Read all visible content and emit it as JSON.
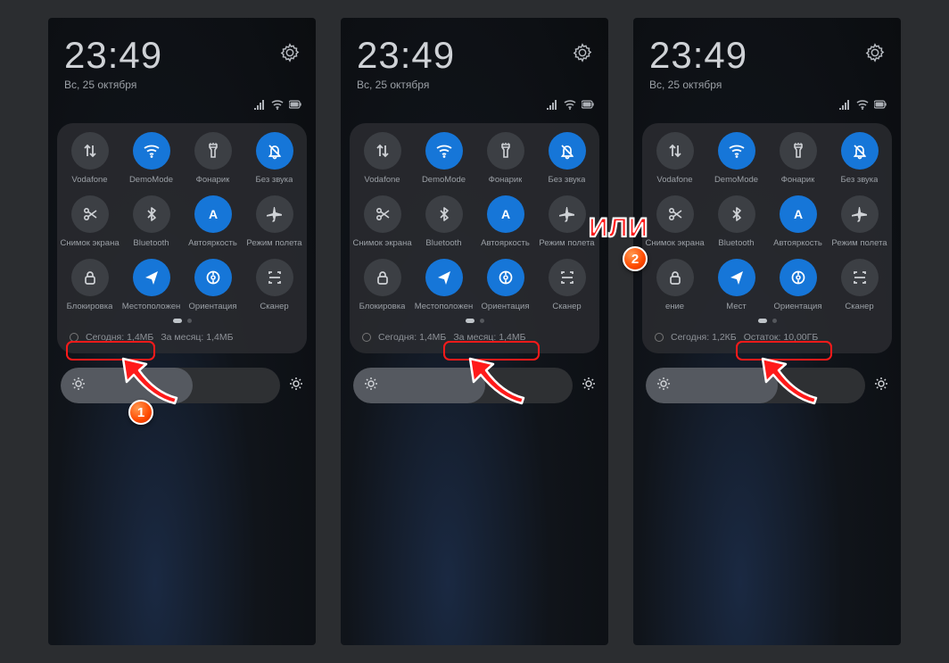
{
  "annotation": {
    "or_label": "ИЛИ",
    "marker1": "1",
    "marker2": "2"
  },
  "common": {
    "time": "23:49",
    "date": "Вс, 25 октября",
    "tiles": [
      {
        "label": "Vodafone",
        "icon": "data-arrows",
        "active": false
      },
      {
        "label": "DemoMode",
        "icon": "wifi",
        "active": true
      },
      {
        "label": "Фонарик",
        "icon": "flashlight",
        "active": false
      },
      {
        "label": "Без звука",
        "icon": "bell-off",
        "active": true
      },
      {
        "label": "Снимок экрана",
        "icon": "scissors",
        "active": false
      },
      {
        "label": "Bluetooth",
        "icon": "bluetooth",
        "active": false
      },
      {
        "label": "Автояркость",
        "icon": "auto-a",
        "active": true
      },
      {
        "label": "Режим полета",
        "icon": "airplane",
        "active": false
      },
      {
        "label": "Блокировка",
        "icon": "lock",
        "active": false
      },
      {
        "label": "Местоположен",
        "icon": "location",
        "active": true
      },
      {
        "label": "Ориентация",
        "icon": "rotate",
        "active": true
      },
      {
        "label": "Сканер",
        "icon": "scan",
        "active": false
      }
    ]
  },
  "screens": [
    {
      "data_today": "Сегодня: 1,4МБ",
      "data_month": "За месяц: 1,4МБ",
      "tile9_label": "Местоположен",
      "highlight": 0
    },
    {
      "data_today": "Сегодня: 1,4МБ",
      "data_month": "За месяц: 1,4МБ",
      "tile9_label": "Местоположен",
      "highlight": 1
    },
    {
      "data_today": "Сегодня: 1,2КБ",
      "data_month": "Остаток: 10,00ГБ",
      "tile9_label": "Мест",
      "highlight": 1
    }
  ]
}
